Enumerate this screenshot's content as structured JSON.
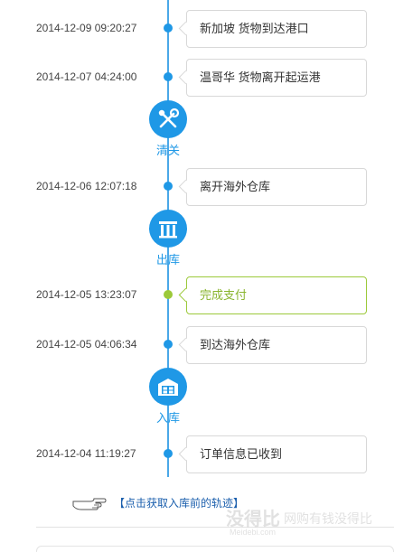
{
  "events": [
    {
      "time": "2014-12-09 09:20:27",
      "text": "新加坡 货物到达港口"
    },
    {
      "time": "2014-12-07 04:24:00",
      "text": "温哥华 货物离开起运港"
    },
    {
      "time": "2014-12-06 12:07:18",
      "text": "离开海外仓库"
    },
    {
      "time": "2014-12-05 13:23:07",
      "text": "完成支付"
    },
    {
      "time": "2014-12-05 04:06:34",
      "text": "到达海外仓库"
    },
    {
      "time": "2014-12-04 11:19:27",
      "text": "订单信息已收到"
    }
  ],
  "milestones": [
    {
      "label": "清关",
      "icon": "customs-clearance-icon"
    },
    {
      "label": "出库",
      "icon": "warehouse-out-icon"
    },
    {
      "label": "入库",
      "icon": "warehouse-in-icon"
    }
  ],
  "link": {
    "text": "【点击获取入库前的轨迹】",
    "icon": "pointing-hand-icon"
  },
  "watermark": {
    "brand": "没得比",
    "slogan": "网购有钱没得比",
    "url": "Meidebi.com"
  },
  "colors": {
    "accent": "#1f98e6",
    "active": "#9cc93a",
    "link": "#1b5fad"
  }
}
